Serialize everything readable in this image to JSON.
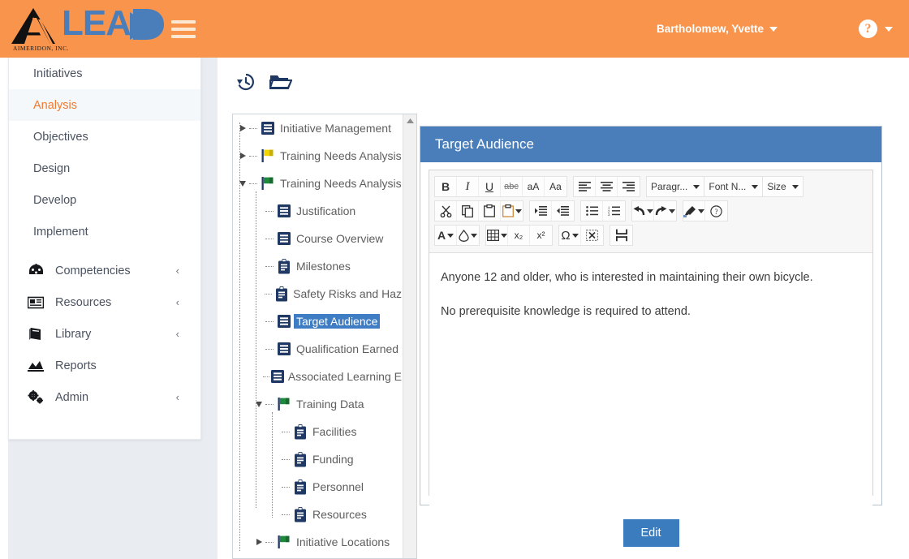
{
  "header": {
    "brand_word": "LEAD",
    "company_name": "AIMERIDON, INC.",
    "menu_icon": "hamburger-icon",
    "user_name": "Bartholomew, Yvette",
    "help_label": "?",
    "accent_color": "#f8944c",
    "brand_blue": "#4a7ebb"
  },
  "sidebar": {
    "items": [
      {
        "label": "Initiatives",
        "active": false,
        "icon": null,
        "chevron": false
      },
      {
        "label": "Analysis",
        "active": true,
        "icon": null,
        "chevron": false
      },
      {
        "label": "Objectives",
        "active": false,
        "icon": null,
        "chevron": false
      },
      {
        "label": "Design",
        "active": false,
        "icon": null,
        "chevron": false
      },
      {
        "label": "Develop",
        "active": false,
        "icon": null,
        "chevron": false
      },
      {
        "label": "Implement",
        "active": false,
        "icon": null,
        "chevron": false
      },
      {
        "label": "Competencies",
        "active": false,
        "icon": "competencies-icon",
        "chevron": true
      },
      {
        "label": "Resources",
        "active": false,
        "icon": "resources-icon",
        "chevron": true
      },
      {
        "label": "Library",
        "active": false,
        "icon": "library-icon",
        "chevron": true
      },
      {
        "label": "Reports",
        "active": false,
        "icon": "reports-icon",
        "chevron": false
      },
      {
        "label": "Admin",
        "active": false,
        "icon": "admin-gears-icon",
        "chevron": true
      }
    ],
    "chevron_glyph": "‹"
  },
  "page_toolbar": {
    "buttons": [
      {
        "name": "history-icon",
        "title": "History"
      },
      {
        "name": "folder-icon",
        "title": "Folder"
      }
    ]
  },
  "tree": {
    "scroll_up_glyph": "▲",
    "nodes": [
      {
        "label": "Initiative Management",
        "indent": 0,
        "icon": "document-icon",
        "expander": "collapsed",
        "selected": false
      },
      {
        "label": "Training Needs Analysis",
        "indent": 0,
        "icon": "flag-yellow-icon",
        "expander": "collapsed",
        "selected": false
      },
      {
        "label": "Training Needs Analysis",
        "indent": 0,
        "icon": "flag-green-icon",
        "expander": "expanded",
        "selected": false
      },
      {
        "label": "Justification",
        "indent": 1,
        "icon": "document-icon",
        "expander": "none",
        "selected": false
      },
      {
        "label": "Course Overview",
        "indent": 1,
        "icon": "document-icon",
        "expander": "none",
        "selected": false
      },
      {
        "label": "Milestones",
        "indent": 1,
        "icon": "clipboard-icon",
        "expander": "none",
        "selected": false
      },
      {
        "label": "Safety Risks and Haz",
        "indent": 1,
        "icon": "clipboard-icon",
        "expander": "none",
        "selected": false
      },
      {
        "label": "Target Audience",
        "indent": 1,
        "icon": "document-icon",
        "expander": "none",
        "selected": true
      },
      {
        "label": "Qualification Earned",
        "indent": 1,
        "icon": "document-icon",
        "expander": "none",
        "selected": false
      },
      {
        "label": "Associated Learning E",
        "indent": 1,
        "icon": "document-icon",
        "expander": "none",
        "selected": false
      },
      {
        "label": "Training Data",
        "indent": 1,
        "icon": "flag-green-icon",
        "expander": "expanded",
        "selected": false
      },
      {
        "label": "Facilities",
        "indent": 2,
        "icon": "clipboard-icon",
        "expander": "none",
        "selected": false
      },
      {
        "label": "Funding",
        "indent": 2,
        "icon": "clipboard-icon",
        "expander": "none",
        "selected": false
      },
      {
        "label": "Personnel",
        "indent": 2,
        "icon": "clipboard-icon",
        "expander": "none",
        "selected": false
      },
      {
        "label": "Resources",
        "indent": 2,
        "icon": "clipboard-icon",
        "expander": "none",
        "selected": false
      },
      {
        "label": "Initiative Locations",
        "indent": 1,
        "icon": "flag-green-icon",
        "expander": "collapsed",
        "selected": false
      }
    ]
  },
  "content": {
    "title": "Target Audience",
    "paragraphs": [
      "Anyone 12 and older, who is interested in maintaining their own bicycle.",
      "No prerequisite knowledge is required to attend."
    ],
    "edit_label": "Edit"
  },
  "editor_toolbar": {
    "row1": {
      "format_group": [
        {
          "name": "bold-icon",
          "glyph": "B",
          "style": "bold"
        },
        {
          "name": "italic-icon",
          "glyph": "I",
          "style": "italic"
        },
        {
          "name": "underline-icon",
          "glyph": "U",
          "style": "underline"
        },
        {
          "name": "strikethrough-icon",
          "glyph": "abc",
          "style": "strike"
        },
        {
          "name": "decrease-font-icon",
          "glyph": "aA",
          "style": "plain"
        },
        {
          "name": "increase-font-icon",
          "glyph": "Aa",
          "style": "plain"
        }
      ],
      "align_group": [
        {
          "name": "align-left-icon"
        },
        {
          "name": "align-center-icon"
        },
        {
          "name": "align-right-icon"
        }
      ],
      "selects": [
        {
          "name": "paragraph-format-select",
          "label": "Paragr..."
        },
        {
          "name": "font-name-select",
          "label": "Font N..."
        },
        {
          "name": "font-size-select",
          "label": "Size"
        }
      ]
    },
    "row2": {
      "clipboard_group": [
        {
          "name": "cut-icon"
        },
        {
          "name": "copy-icon"
        },
        {
          "name": "paste-icon"
        },
        {
          "name": "paste-options-icon",
          "has_arrow": true
        }
      ],
      "indent_group": [
        {
          "name": "indent-increase-icon"
        },
        {
          "name": "indent-decrease-icon"
        }
      ],
      "list_group": [
        {
          "name": "bullet-list-icon"
        },
        {
          "name": "numbered-list-icon"
        }
      ],
      "history_group": [
        {
          "name": "undo-icon",
          "has_arrow": true
        },
        {
          "name": "redo-icon",
          "has_arrow": true
        }
      ],
      "misc_group": [
        {
          "name": "format-painter-icon",
          "has_arrow": true
        },
        {
          "name": "help-circle-icon"
        }
      ]
    },
    "row3": {
      "color_group": [
        {
          "name": "text-color-icon",
          "glyph": "A",
          "has_arrow": true
        },
        {
          "name": "highlight-color-icon",
          "glyph": "drop",
          "has_arrow": true
        }
      ],
      "table_group": [
        {
          "name": "insert-table-icon",
          "has_arrow": true
        },
        {
          "name": "subscript-icon",
          "glyph": "x₂"
        },
        {
          "name": "superscript-icon",
          "glyph": "x²"
        }
      ],
      "symbol_group": [
        {
          "name": "special-character-icon",
          "glyph": "Ω",
          "has_arrow": true
        },
        {
          "name": "select-all-icon"
        }
      ],
      "break_group": [
        {
          "name": "page-break-icon"
        }
      ]
    }
  }
}
